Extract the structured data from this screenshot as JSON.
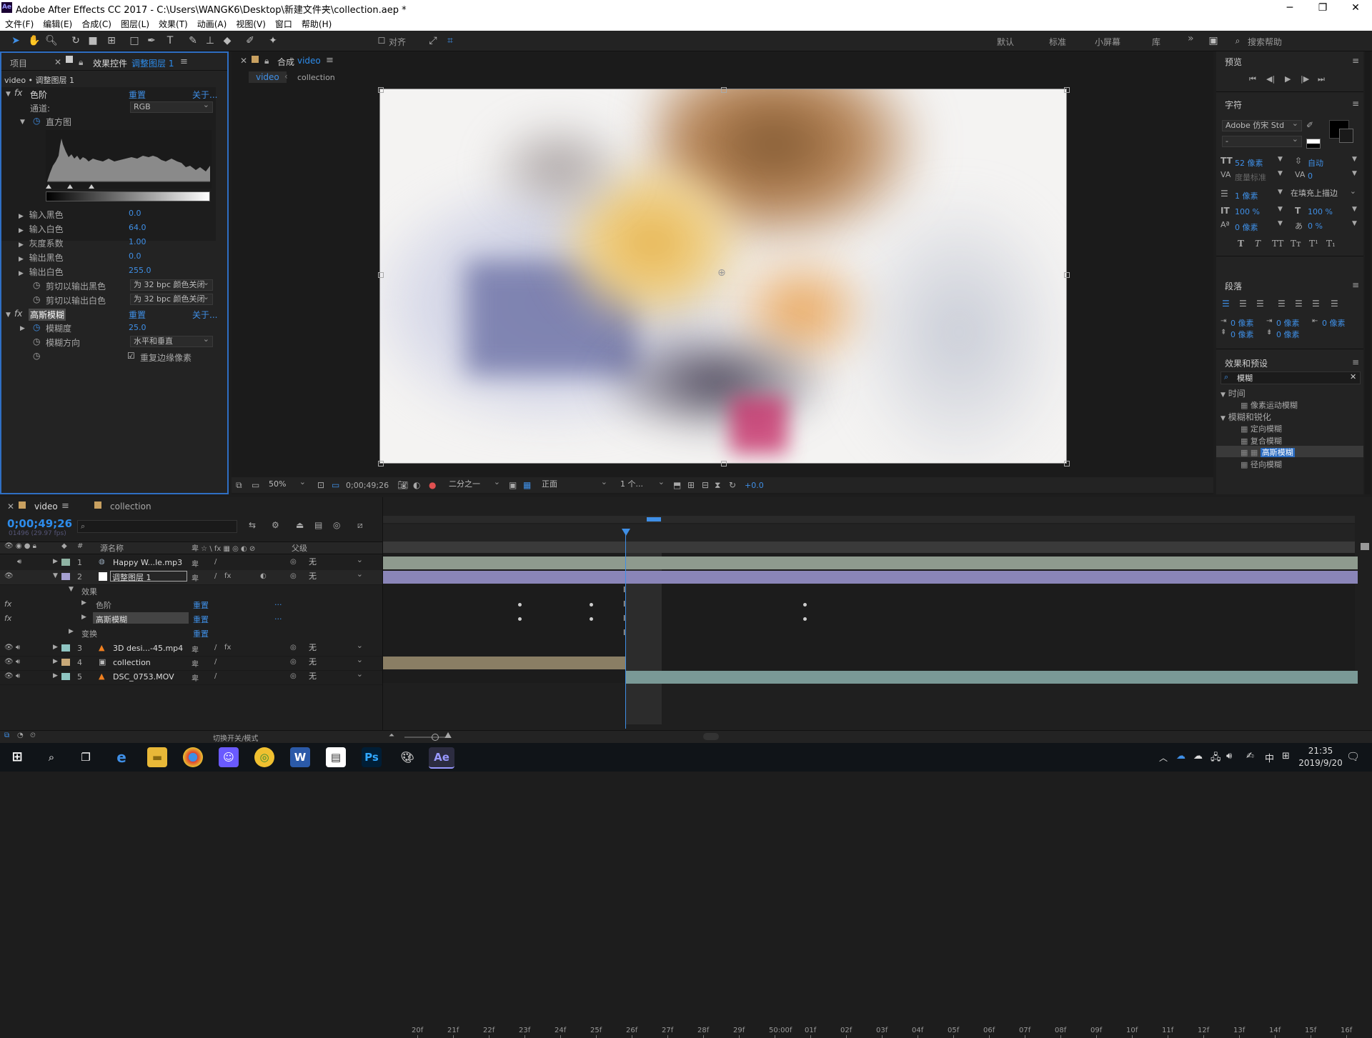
{
  "app": {
    "icon_text": "Ae",
    "title": "Adobe After Effects CC 2017 - C:\\Users\\WANGK6\\Desktop\\新建文件夹\\collection.aep *"
  },
  "window_buttons": {
    "minimize": "─",
    "restore": "❐",
    "close": "✕"
  },
  "menu": [
    "文件(F)",
    "编辑(E)",
    "合成(C)",
    "图层(L)",
    "效果(T)",
    "动画(A)",
    "视图(V)",
    "窗口",
    "帮助(H)"
  ],
  "toolbar": {
    "snap_label": "对齐",
    "workspaces": [
      "默认",
      "标准",
      "小屏幕",
      "库"
    ],
    "more": "»",
    "search_help": "搜索帮助"
  },
  "left_panel": {
    "tab_project": "项目",
    "tab_effects": "效果控件",
    "tab_effects_layer": "调整图层 1",
    "breadcrumb": "video • 调整图层 1",
    "levels": {
      "name": "色阶",
      "reset": "重置",
      "about": "关于...",
      "channel_label": "通道:",
      "channel_value": "RGB",
      "histogram_label": "直方图",
      "params": [
        {
          "label": "输入黑色",
          "value": "0.0"
        },
        {
          "label": "输入白色",
          "value": "64.0"
        },
        {
          "label": "灰度系数",
          "value": "1.00"
        },
        {
          "label": "输出黑色",
          "value": "0.0"
        },
        {
          "label": "输出白色",
          "value": "255.0"
        }
      ],
      "clip_black_label": "剪切以输出黑色",
      "clip_black_value": "为 32 bpc 颜色关闭",
      "clip_white_label": "剪切以输出白色",
      "clip_white_value": "为 32 bpc 颜色关闭"
    },
    "blur": {
      "name": "高斯模糊",
      "reset": "重置",
      "about": "关于...",
      "blurriness_label": "模糊度",
      "blurriness_value": "25.0",
      "direction_label": "模糊方向",
      "direction_value": "水平和垂直",
      "repeat_edge_label": "重复边缘像素",
      "repeat_edge_checked": true
    }
  },
  "comp_viewer": {
    "panel_label": "合成",
    "panel_name": "video",
    "flow": [
      "video",
      "collection"
    ],
    "zoom": "50%",
    "timecode": "0;00;49;26",
    "resolution": "二分之一",
    "view": "正面",
    "views_count": "1 个...",
    "exposure": "+0.0"
  },
  "right_panel": {
    "preview_title": "预览",
    "character_title": "字符",
    "font_name": "Adobe 仿宋 Std",
    "font_style": "-",
    "font_size": "52 像素",
    "leading": "自动",
    "kerning": "度量标准",
    "tracking": "0",
    "stroke_width": "1 像素",
    "stroke_type": "在填充上描边",
    "vert_scale": "100 %",
    "horiz_scale": "100 %",
    "baseline": "0 像素",
    "tsume": "0 %",
    "type_styles": [
      "T",
      "T",
      "TT",
      "Tт",
      "T¹",
      "T₁"
    ],
    "paragraph_title": "段落",
    "indent_left": "0 像素",
    "indent_first": "0 像素",
    "indent_right": "0 像素",
    "space_before": "0 像素",
    "space_after": "0 像素",
    "effects_title": "效果和预设",
    "search_value": "模糊",
    "categories": [
      {
        "name": "时间",
        "items": [
          "像素运动模糊"
        ]
      },
      {
        "name": "模糊和锐化",
        "items": [
          "定向模糊",
          "复合模糊",
          "高斯模糊",
          "径向模糊"
        ]
      }
    ]
  },
  "timeline": {
    "tab_video": "video",
    "tab_collection": "collection",
    "timecode": "0;00;49;26",
    "fps_note": "01496 (29.97 fps)",
    "col_source": "源名称",
    "col_parent": "父级",
    "ruler": [
      "20f",
      "21f",
      "22f",
      "23f",
      "24f",
      "25f",
      "26f",
      "27f",
      "28f",
      "29f",
      "50:00f",
      "01f",
      "02f",
      "03f",
      "04f",
      "05f",
      "06f",
      "07f",
      "08f",
      "09f",
      "10f",
      "11f",
      "12f",
      "13f",
      "14f",
      "15f",
      "16f"
    ],
    "layers": [
      {
        "num": "1",
        "name": "Happy W...le.mp3",
        "parent": "无"
      },
      {
        "num": "2",
        "name": "调整图层 1",
        "parent": "无"
      },
      {
        "num": "3",
        "name": "3D desi...-45.mp4",
        "parent": "无"
      },
      {
        "num": "4",
        "name": "collection",
        "parent": "无"
      },
      {
        "num": "5",
        "name": "DSC_0753.MOV",
        "parent": "无"
      }
    ],
    "sub_effects": "效果",
    "sub_levels": "色阶",
    "sub_blur": "高斯模糊",
    "sub_transform": "变换",
    "reset": "重置",
    "dots": "...",
    "bottom_toggle": "切换开关/模式"
  },
  "taskbar": {
    "time": "21:35",
    "date": "2019/9/20",
    "ime": "中"
  },
  "colors": {
    "accent_blue": "#2d8ceb",
    "panel_bg": "#232323",
    "active_border": "#2f6fc4"
  }
}
